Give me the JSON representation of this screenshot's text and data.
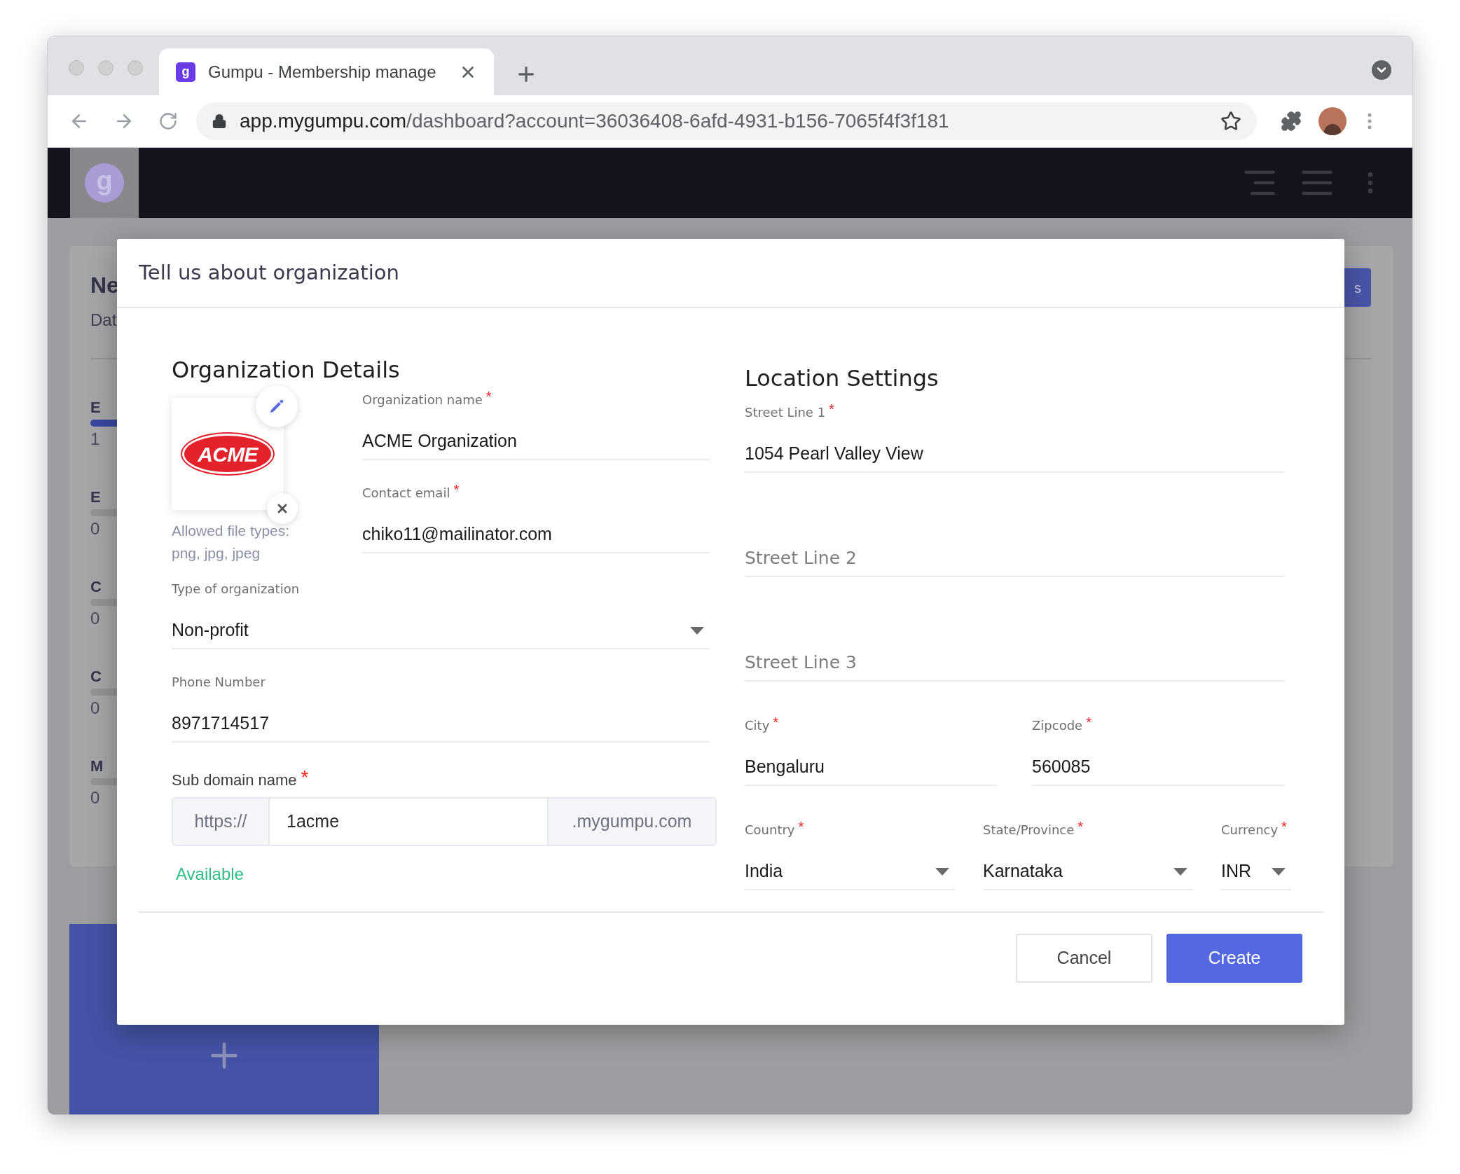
{
  "browser": {
    "tab": {
      "favicon_letter": "g",
      "title": "Gumpu - Membership manage"
    },
    "url": {
      "host": "app.mygumpu.com",
      "path": "/dashboard?account=36036408-6afd-4931-b156-7065f4f3f181"
    }
  },
  "app_header": {
    "logo_letter": "g"
  },
  "background": {
    "title": "Ne",
    "subtitle": "Dat",
    "button_label": "s",
    "stats": [
      {
        "label": "E",
        "value": "1",
        "color": "#3b47a0"
      },
      {
        "label": "E",
        "value": "0",
        "color": "#939396"
      },
      {
        "label": "C",
        "value": "0",
        "color": "#939396"
      },
      {
        "label": "C",
        "value": "0",
        "color": "#939396"
      },
      {
        "label": "M",
        "value": "0",
        "color": "#939396"
      }
    ]
  },
  "modal": {
    "title": "Tell us about organization",
    "organization": {
      "heading": "Organization Details",
      "logo_text": "ACME",
      "file_hint": "Allowed file types: png, jpg, jpeg",
      "fields_beside_logo": [
        {
          "kind": "text",
          "label": "Organization name",
          "required_mark": "*",
          "value": "ACME Organization"
        },
        {
          "kind": "text",
          "label": "Contact email",
          "required_mark": "*",
          "value": "chiko11@mailinator.com"
        }
      ],
      "fields": [
        {
          "kind": "select",
          "label": "Type of organization",
          "value": "Non-profit"
        },
        {
          "kind": "text",
          "label": "Phone Number",
          "value": "8971714517"
        }
      ],
      "subdomain": {
        "label": "Sub domain name",
        "required_mark": "*",
        "prefix": "https://",
        "value": "1acme",
        "suffix": ".mygumpu.com"
      },
      "availability": "Available"
    },
    "location": {
      "heading": "Location Settings",
      "rows": [
        [
          {
            "kind": "text",
            "label": "Street Line 1",
            "required_mark": "*",
            "value": "1054 Pearl Valley View"
          }
        ],
        [
          {
            "kind": "text",
            "placeholder": "Street Line 2"
          }
        ],
        [
          {
            "kind": "text",
            "placeholder": "Street Line 3"
          }
        ],
        [
          {
            "kind": "text",
            "label": "City",
            "required_mark": "*",
            "value": "Bengaluru"
          },
          {
            "kind": "text",
            "label": "Zipcode",
            "required_mark": "*",
            "value": "560085"
          }
        ],
        [
          {
            "kind": "select",
            "label": "Country",
            "required_mark": "*",
            "value": "India"
          },
          {
            "kind": "select",
            "label": "State/Province",
            "required_mark": "*",
            "value": "Karnataka"
          },
          {
            "kind": "select",
            "label": "Currency",
            "required_mark": "*",
            "value": "INR"
          }
        ]
      ]
    },
    "buttons": [
      {
        "kind": "secondary",
        "label": "Cancel"
      },
      {
        "kind": "primary",
        "label": "Create"
      }
    ]
  }
}
